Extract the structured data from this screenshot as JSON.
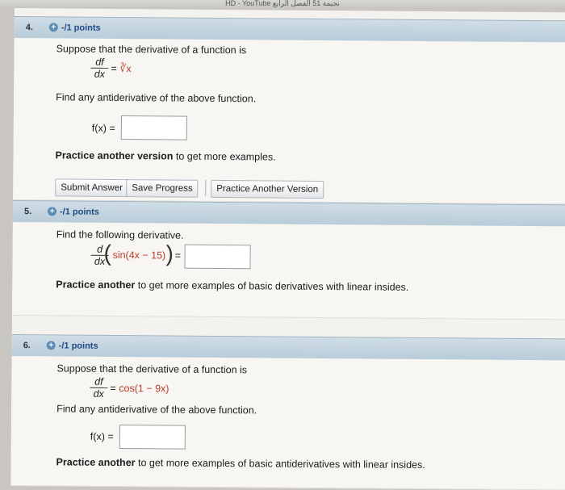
{
  "topbar": {
    "text": "HD - YouTube نجيمة 51 الفصل الرابع"
  },
  "questions": [
    {
      "number": "4.",
      "points": "-/1 points",
      "intro": "Suppose that the derivative of a function is",
      "deriv_num": "df",
      "deriv_den": "dx",
      "equals": "=",
      "rhs": "∛x",
      "task": "Find any antiderivative of the above function.",
      "answer_label": "f(x) =",
      "practice_bold": "Practice another version",
      "practice_rest": " to get more examples.",
      "buttons": [
        "Submit Answer",
        "Save Progress",
        "Practice Another Version"
      ]
    },
    {
      "number": "5.",
      "points": "-/1 points",
      "intro": "Find the following derivative.",
      "deriv_num": "d",
      "deriv_den": "dx",
      "inner": "sin(4x − 15)",
      "equals": "=",
      "practice_bold": "Practice another",
      "practice_rest": " to get more examples of basic derivatives with linear insides."
    },
    {
      "number": "6.",
      "points": "-/1 points",
      "intro": "Suppose that the derivative of a function is",
      "deriv_num": "df",
      "deriv_den": "dx",
      "equals": "=",
      "rhs": "cos(1 − 9x)",
      "task": "Find any antiderivative of the above function.",
      "answer_label": "f(x) =",
      "practice_bold": "Practice another",
      "practice_rest": " to get more examples of basic antiderivatives with linear insides."
    }
  ]
}
